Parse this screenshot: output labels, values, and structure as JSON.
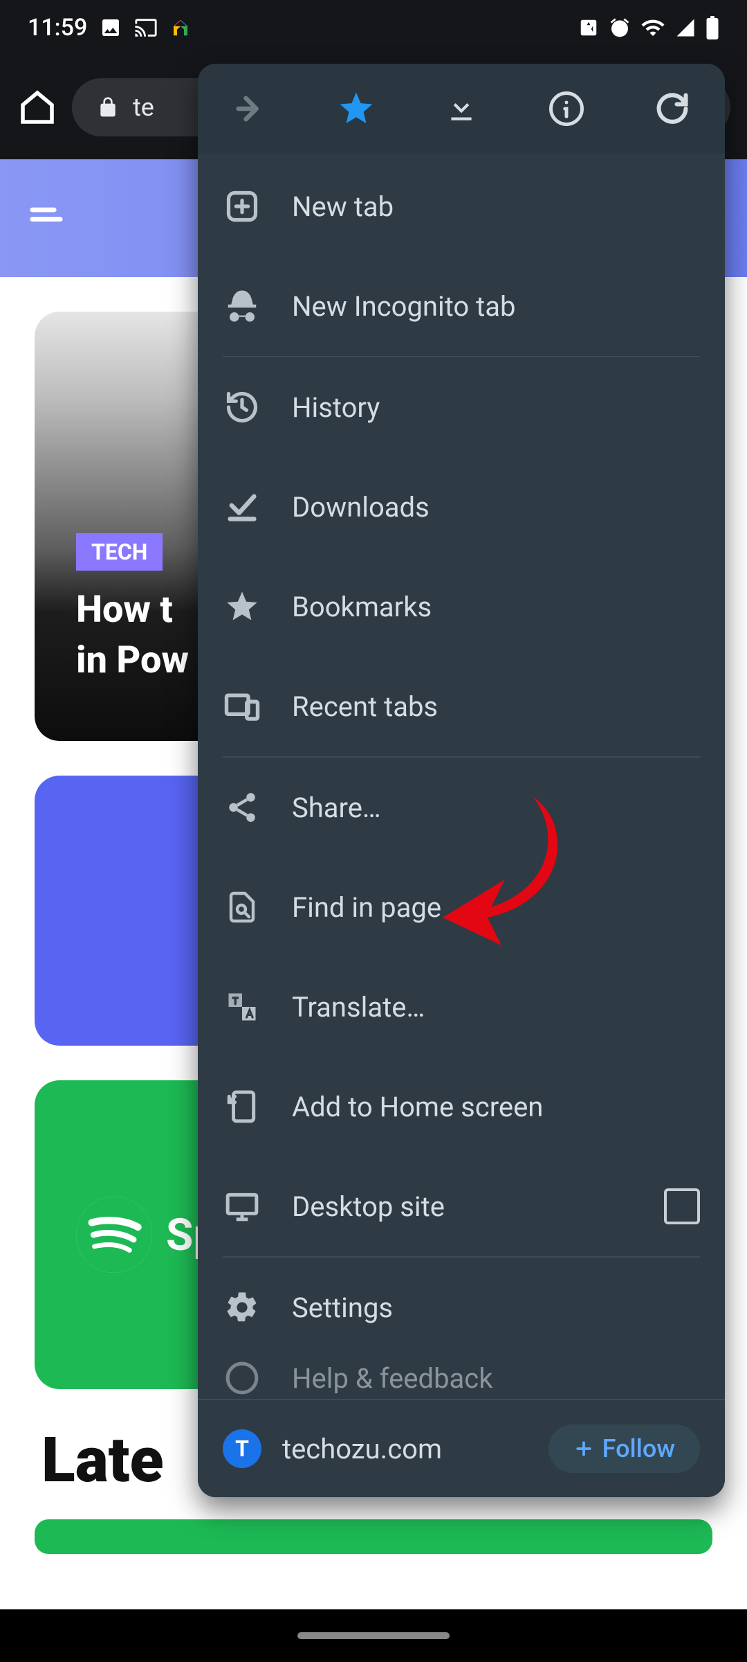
{
  "status": {
    "time": "11:59"
  },
  "urlbar": {
    "text": "te"
  },
  "page": {
    "tag": "TECH",
    "headline": "How t\nin Pow",
    "card3_text": "Spot",
    "latest": "Late"
  },
  "menu": {
    "items": [
      {
        "icon": "plus-box-icon",
        "label": "New tab"
      },
      {
        "icon": "incognito-icon",
        "label": "New Incognito tab"
      },
      {
        "divider": true
      },
      {
        "icon": "history-icon",
        "label": "History"
      },
      {
        "icon": "check-underline-icon",
        "label": "Downloads"
      },
      {
        "icon": "star-icon",
        "label": "Bookmarks"
      },
      {
        "icon": "devices-icon",
        "label": "Recent tabs"
      },
      {
        "divider": true
      },
      {
        "icon": "share-icon",
        "label": "Share…"
      },
      {
        "icon": "find-in-page-icon",
        "label": "Find in page"
      },
      {
        "icon": "translate-icon",
        "label": "Translate…"
      },
      {
        "icon": "add-home-icon",
        "label": "Add to Home screen"
      },
      {
        "icon": "desktop-icon",
        "label": "Desktop site",
        "checkbox": true
      },
      {
        "divider": true
      },
      {
        "icon": "gear-icon",
        "label": "Settings"
      },
      {
        "icon": "help-icon",
        "label": "Help & feedback"
      }
    ],
    "footer": {
      "badge": "T",
      "site": "techozu.com",
      "follow": "Follow"
    }
  }
}
